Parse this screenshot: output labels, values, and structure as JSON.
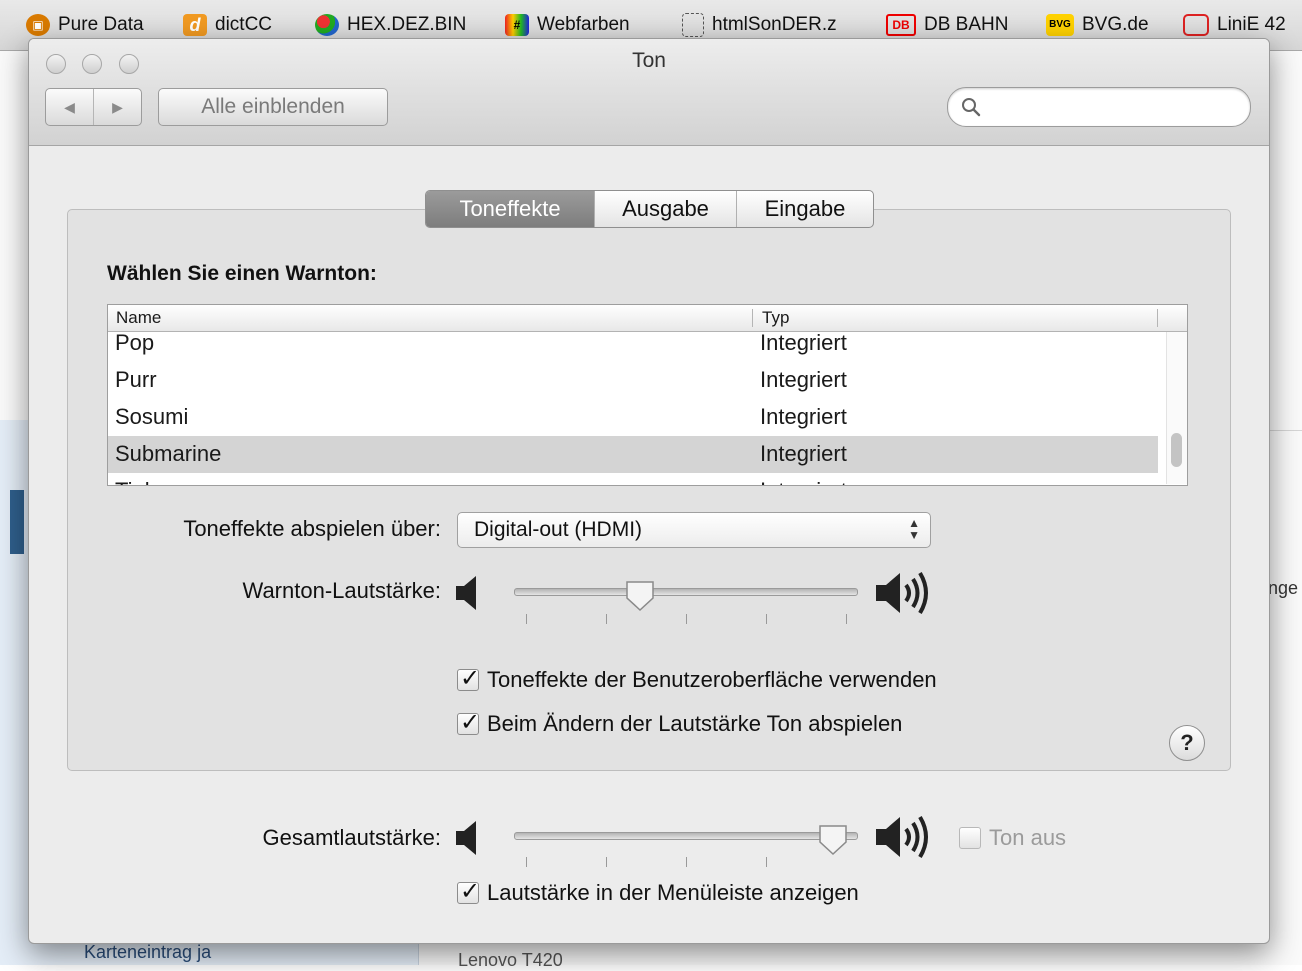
{
  "browser": {
    "bookmarks": [
      {
        "label": "Pure Data",
        "icon": "pure-data-icon"
      },
      {
        "label": "dictCC",
        "icon": "dictcc-icon"
      },
      {
        "label": "HEX.DEZ.BIN",
        "icon": "hex-icon"
      },
      {
        "label": "Webfarben",
        "icon": "webfarben-icon"
      },
      {
        "label": "htmlSonDER.z",
        "icon": "dotted-box-icon"
      },
      {
        "label": "DB BAHN",
        "icon": "db-icon"
      },
      {
        "label": "BVG.de",
        "icon": "bvg-icon"
      },
      {
        "label": "LiniE 42",
        "icon": "bus-icon"
      }
    ],
    "background": {
      "left_text": "Karteneintrag  ja",
      "bottom_text": "Lenovo T420",
      "right_text": "nge"
    }
  },
  "window": {
    "title": "Ton",
    "show_all_label": "Alle einblenden",
    "search_placeholder": ""
  },
  "tabs": [
    {
      "label": "Toneffekte",
      "active": true
    },
    {
      "label": "Ausgabe",
      "active": false
    },
    {
      "label": "Eingabe",
      "active": false
    }
  ],
  "section_title": "Wählen Sie einen Warnton:",
  "table": {
    "columns": [
      "Name",
      "Typ"
    ],
    "rows": [
      {
        "name": "Pop",
        "type": "Integriert",
        "selected": false
      },
      {
        "name": "Purr",
        "type": "Integriert",
        "selected": false
      },
      {
        "name": "Sosumi",
        "type": "Integriert",
        "selected": false
      },
      {
        "name": "Submarine",
        "type": "Integriert",
        "selected": true
      },
      {
        "name": "Tink",
        "type": "Integriert",
        "selected": false
      }
    ]
  },
  "playback": {
    "label": "Toneffekte abspielen über:",
    "value": "Digital-out (HDMI)"
  },
  "alert_volume": {
    "label": "Warnton-Lautstärke:",
    "level": 0.36
  },
  "checkboxes": {
    "ui_effects": {
      "label": "Toneffekte der Benutzeroberfläche verwenden",
      "checked": true
    },
    "feedback": {
      "label": "Beim Ändern der Lautstärke Ton abspielen",
      "checked": true
    },
    "menubar": {
      "label": "Lautstärke in der Menüleiste anzeigen",
      "checked": true
    }
  },
  "output_volume": {
    "label": "Gesamtlautstärke:",
    "level": 0.96,
    "mute_label": "Ton aus",
    "muted": false
  },
  "help_label": "?"
}
